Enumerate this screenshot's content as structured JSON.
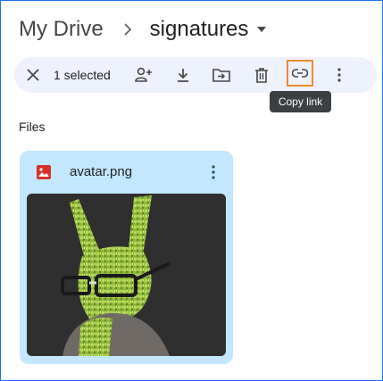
{
  "breadcrumb": {
    "root": "My Drive",
    "current": "signatures",
    "separator_icon": "chevron-right-icon",
    "dropdown_icon": "caret-down-icon"
  },
  "toolbar": {
    "selection_count": "1 selected",
    "icons": [
      "close-icon",
      "share-person-icon",
      "download-icon",
      "move-to-folder-icon",
      "trash-icon",
      "link-icon",
      "more-vert-icon"
    ],
    "tooltip": "Copy link",
    "background": "#edf2fc",
    "highlight_color": "#f08b2f"
  },
  "files_section": {
    "label": "Files"
  },
  "files": [
    {
      "name": "avatar.png",
      "type_icon": "image-file-icon",
      "icon_color": "#d93025",
      "thumbnail": "green rabbit with glasses",
      "card_color": "#c2e7ff"
    }
  ]
}
